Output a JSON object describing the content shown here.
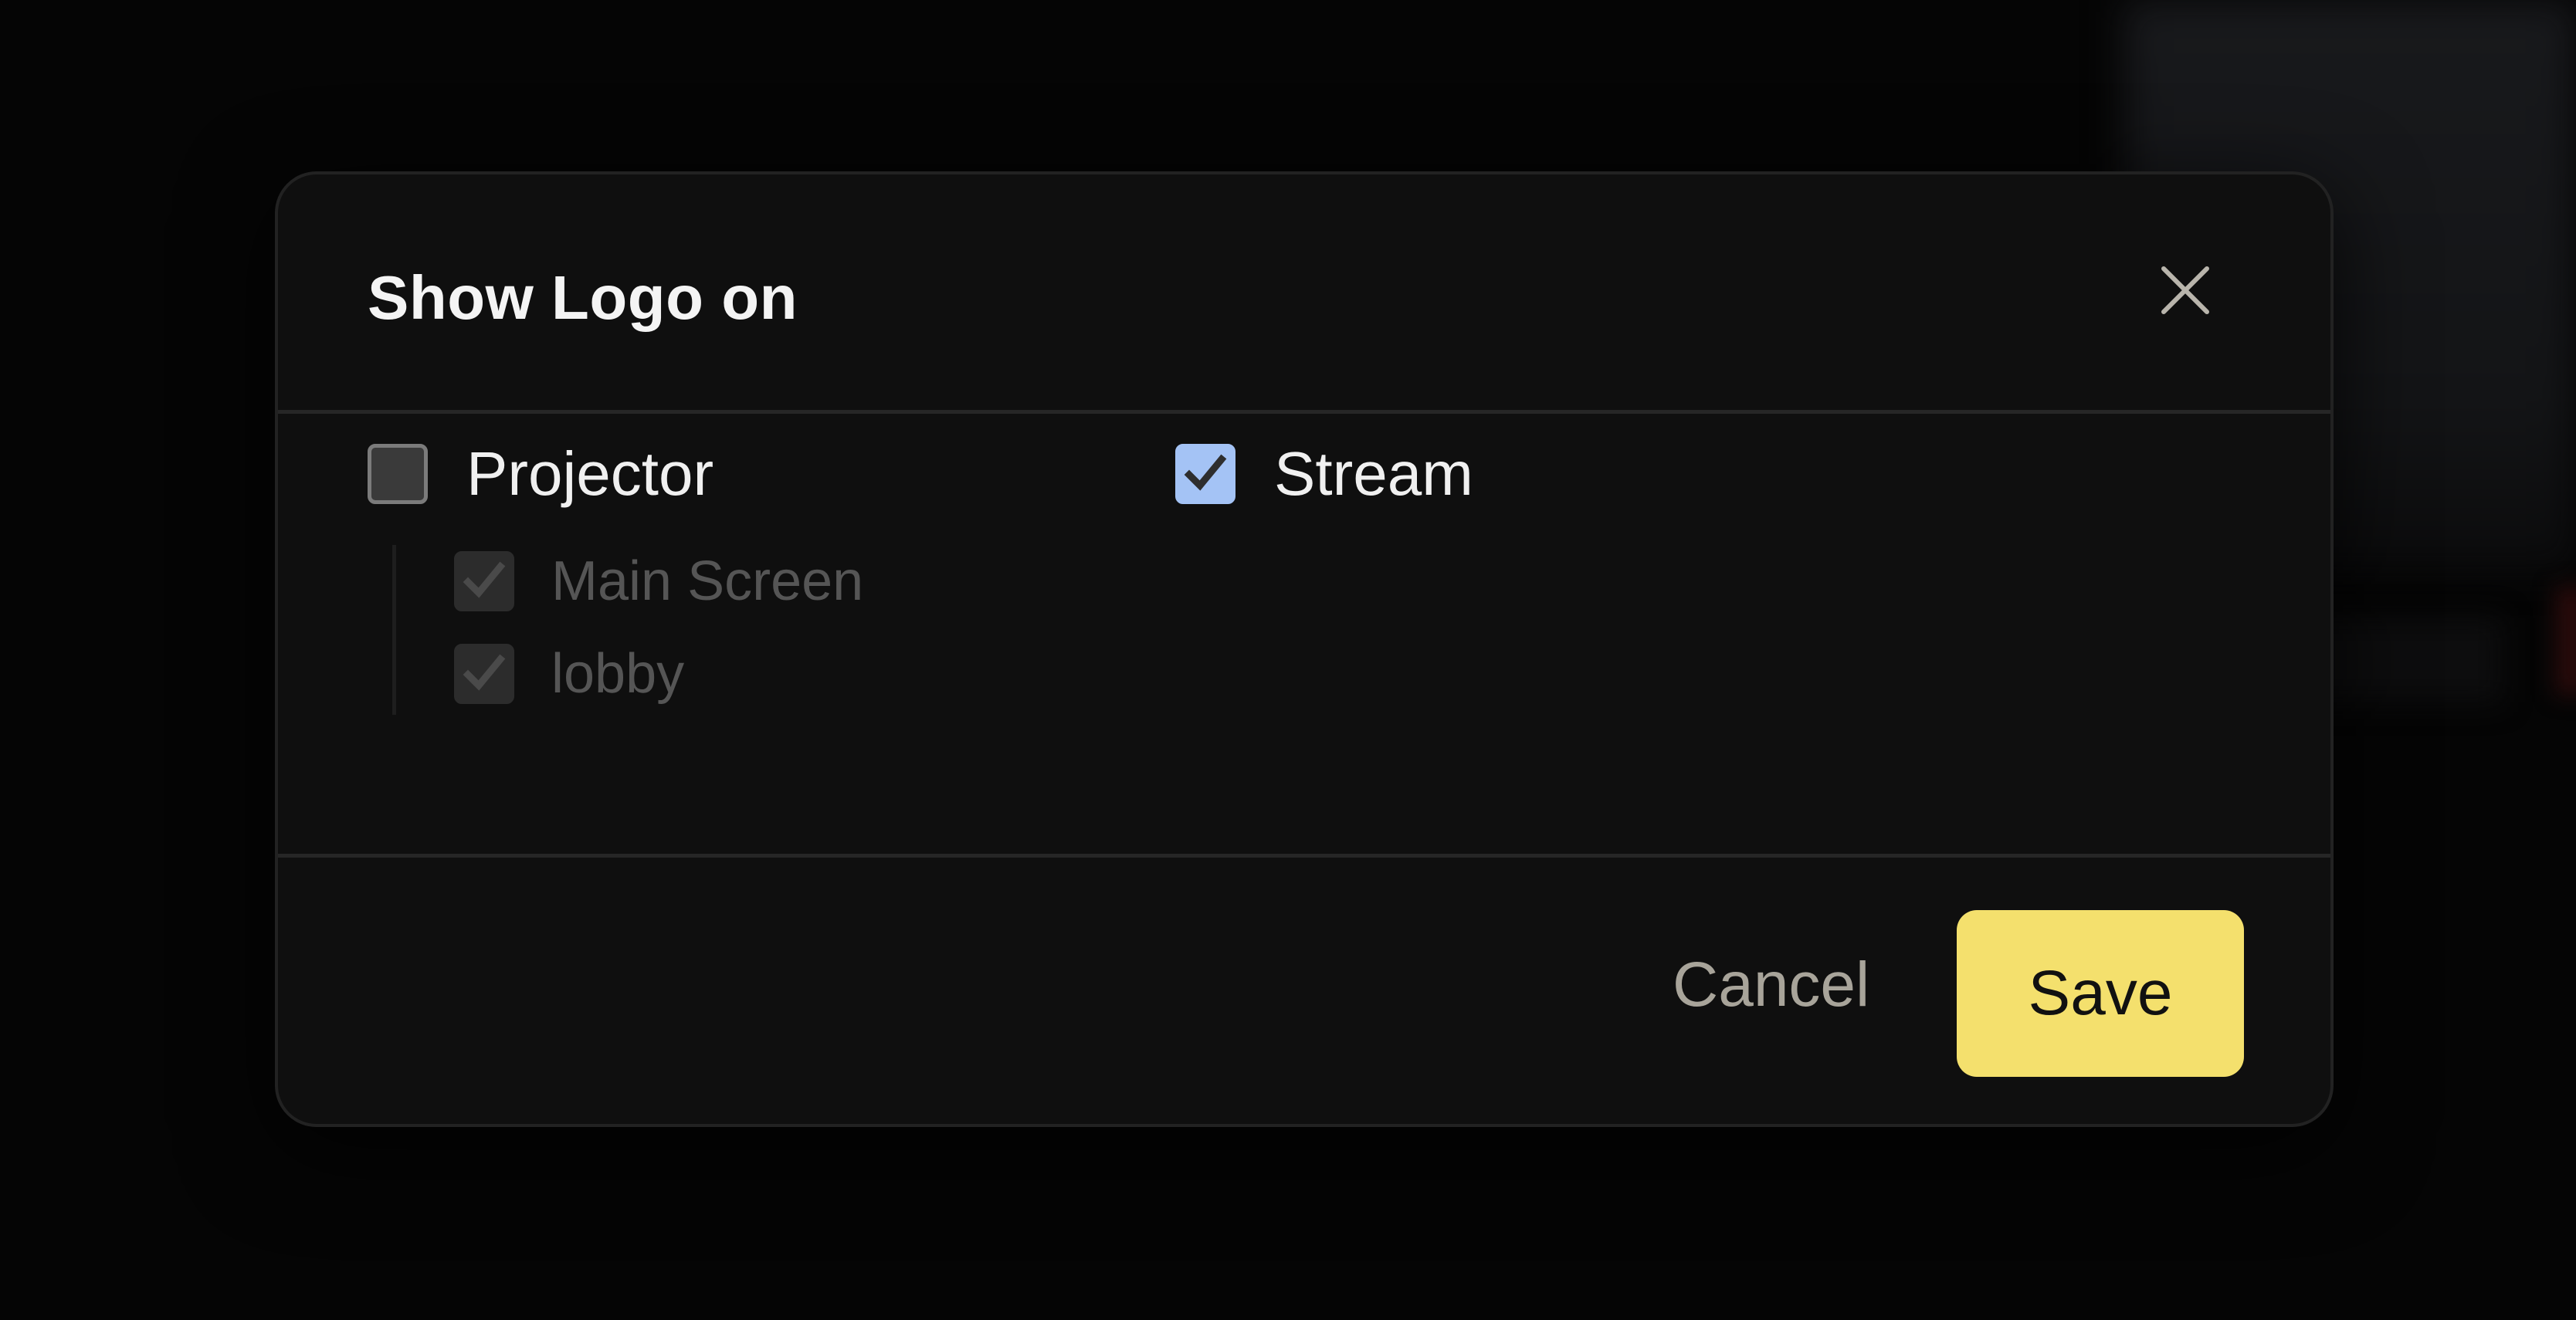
{
  "dialog": {
    "title": "Show Logo on",
    "close_icon": "close-icon"
  },
  "options": {
    "projector": {
      "label": "Projector",
      "checked": false,
      "children": [
        {
          "label": "Main Screen",
          "checked": true,
          "disabled": true
        },
        {
          "label": "lobby",
          "checked": true,
          "disabled": true
        }
      ]
    },
    "stream": {
      "label": "Stream",
      "checked": true
    }
  },
  "footer": {
    "cancel_label": "Cancel",
    "save_label": "Save"
  },
  "colors": {
    "accent_yellow": "#f4e06d",
    "checkbox_checked": "#a4c3f5",
    "dialog_bg": "#0f0f0f"
  }
}
